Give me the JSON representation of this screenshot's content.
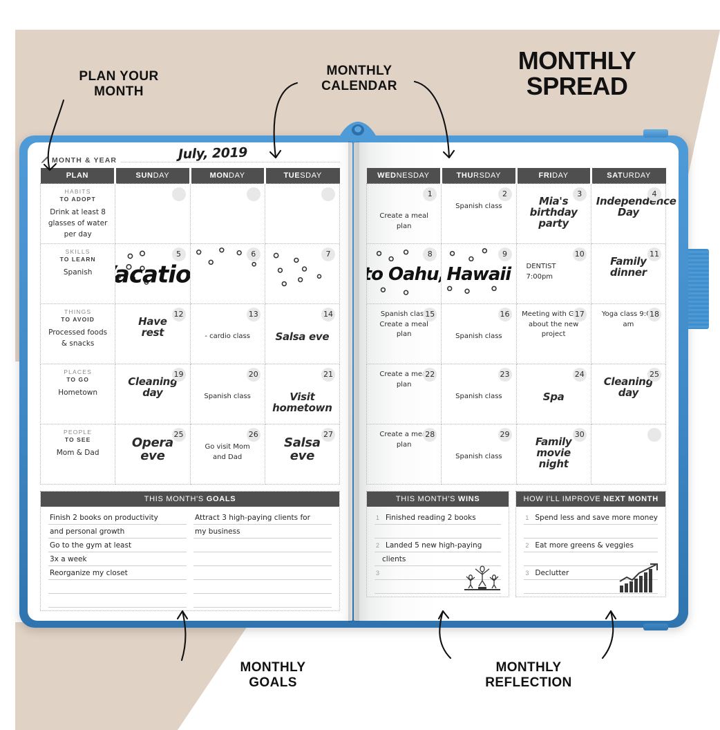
{
  "annotations": {
    "plan_your_month": "PLAN YOUR\nMONTH",
    "plan_your_month_l1": "PLAN YOUR",
    "plan_your_month_l2": "MONTH",
    "monthly_calendar_l1": "MONTHLY",
    "monthly_calendar_l2": "CALENDAR",
    "title_l1": "MONTHLY",
    "title_l2": "SPREAD",
    "monthly_goals_l1": "MONTHLY",
    "monthly_goals_l2": "GOALS",
    "monthly_reflection_l1": "MONTHLY",
    "monthly_reflection_l2": "REFLECTION"
  },
  "colors": {
    "backdrop_beige": "#e0d2c5",
    "cover_blue": "#3f88c6",
    "header_grey": "#4f4f4f",
    "daynum_circle": "#e8e8e8",
    "page_white": "#ffffff"
  },
  "header": {
    "icon": "pen-icon",
    "label": "MONTH & YEAR",
    "value": "July, 2019"
  },
  "left_page": {
    "columns": [
      {
        "bold": "PLAN",
        "rest": ""
      },
      {
        "bold": "SUN",
        "rest": "DAY"
      },
      {
        "bold": "MON",
        "rest": "DAY"
      },
      {
        "bold": "TUE",
        "rest": "SDAY"
      }
    ],
    "plan_sections": [
      {
        "title_top": "HABITS",
        "title_bottom": "TO ADOPT",
        "body": "Drink at least 8 glasses of water per day"
      },
      {
        "title_top": "SKILLS",
        "title_bottom": "TO LEARN",
        "body": "Spanish"
      },
      {
        "title_top": "THINGS",
        "title_bottom": "TO AVOID",
        "body": "Processed foods & snacks"
      },
      {
        "title_top": "PLACES",
        "title_bottom": "TO GO",
        "body": "Hometown"
      },
      {
        "title_top": "PEOPLE",
        "title_bottom": "TO SEE",
        "body": "Mom & Dad"
      }
    ],
    "weeks": [
      [
        {
          "day": "",
          "text": ""
        },
        {
          "day": "",
          "text": ""
        },
        {
          "day": "",
          "text": ""
        }
      ],
      [
        {
          "day": "5",
          "text": "",
          "banner": "Vacation"
        },
        {
          "day": "6",
          "text": ""
        },
        {
          "day": "7",
          "text": ""
        }
      ],
      [
        {
          "day": "12",
          "text": "Have\nrest",
          "style": "script"
        },
        {
          "day": "13",
          "text": "- cardio class"
        },
        {
          "day": "14",
          "text": "Salsa eve",
          "style": "script-small"
        }
      ],
      [
        {
          "day": "19",
          "text": "Cleaning\nday",
          "style": "script"
        },
        {
          "day": "20",
          "text": "Spanish class"
        },
        {
          "day": "21",
          "text": "Visit hometown",
          "style": "script-small"
        }
      ],
      [
        {
          "day": "25",
          "text": "Opera\neve",
          "style": "script-bold"
        },
        {
          "day": "26",
          "text": "Go visit Mom\nand Dad"
        },
        {
          "day": "27",
          "text": "Salsa\neve",
          "style": "script-bold"
        }
      ]
    ]
  },
  "right_page": {
    "columns": [
      {
        "bold": "WED",
        "rest": "NESDAY"
      },
      {
        "bold": "THU",
        "rest": "RSDAY"
      },
      {
        "bold": "FRI",
        "rest": "DAY"
      },
      {
        "bold": "SAT",
        "rest": "URDAY"
      }
    ],
    "weeks": [
      [
        {
          "day": "1",
          "text": "Create a meal plan"
        },
        {
          "day": "2",
          "text": "Spanish class"
        },
        {
          "day": "3",
          "text": "Mia's\nbirthday\nparty",
          "style": "script-bold"
        },
        {
          "day": "4",
          "text": "Independence\nDay",
          "style": "script-small"
        }
      ],
      [
        {
          "day": "8",
          "text": "",
          "banner": "to Oahu,"
        },
        {
          "day": "9",
          "text": "",
          "banner": "Hawaii"
        },
        {
          "day": "10",
          "text": "DENTIST\n7:00pm"
        },
        {
          "day": "11",
          "text": "Family\ndinner",
          "style": "script-bold"
        }
      ],
      [
        {
          "day": "15",
          "text": "Spanish class\nCreate a meal plan",
          "align": "top"
        },
        {
          "day": "16",
          "text": "Spanish class"
        },
        {
          "day": "17",
          "text": "Meeting with Greg\nabout the new\nproject",
          "align": "top"
        },
        {
          "day": "18",
          "text": "Yoga class 9:00 am",
          "align": "top"
        }
      ],
      [
        {
          "day": "22",
          "text": "Create a meal plan",
          "align": "top"
        },
        {
          "day": "23",
          "text": "Spanish class",
          "align": "low"
        },
        {
          "day": "24",
          "text": "Spa",
          "style": "script-small"
        },
        {
          "day": "25",
          "text": "Cleaning\nday",
          "style": "script"
        }
      ],
      [
        {
          "day": "28",
          "text": "Create a meal plan",
          "align": "top"
        },
        {
          "day": "29",
          "text": "Spanish class",
          "align": "low"
        },
        {
          "day": "30",
          "text": "Family\nmovie\nnight",
          "style": "script-bold"
        },
        {
          "day": "",
          "text": ""
        }
      ]
    ]
  },
  "goals": {
    "head_normal": "THIS MONTH'S ",
    "head_bold": "GOALS",
    "left_lines": [
      "Finish 2 books on productivity",
      "and personal growth",
      "Go to the gym at least",
      "3x a week",
      "Reorganize my closet",
      "",
      ""
    ],
    "right_lines": [
      "Attract 3 high-paying clients for",
      "my business",
      "",
      "",
      "",
      "",
      ""
    ]
  },
  "wins": {
    "head_normal": "THIS MONTH'S ",
    "head_bold": "WINS",
    "items": [
      {
        "num": "1",
        "text": "Finished reading 2 books"
      },
      {
        "num": "",
        "text": ""
      },
      {
        "num": "2",
        "text": "Landed 5 new high-paying"
      },
      {
        "num": "",
        "text": "clients"
      },
      {
        "num": "3",
        "text": ""
      },
      {
        "num": "",
        "text": ""
      }
    ],
    "doodle": "celebration-people-icon"
  },
  "improve": {
    "head_normal": "HOW I'LL IMPROVE ",
    "head_bold": "NEXT MONTH",
    "items": [
      {
        "num": "1",
        "text": "Spend less and save more money"
      },
      {
        "num": "",
        "text": ""
      },
      {
        "num": "2",
        "text": "Eat more greens & veggies"
      },
      {
        "num": "",
        "text": ""
      },
      {
        "num": "3",
        "text": "Declutter"
      },
      {
        "num": "",
        "text": ""
      }
    ],
    "doodle": "growth-bar-chart-icon"
  }
}
